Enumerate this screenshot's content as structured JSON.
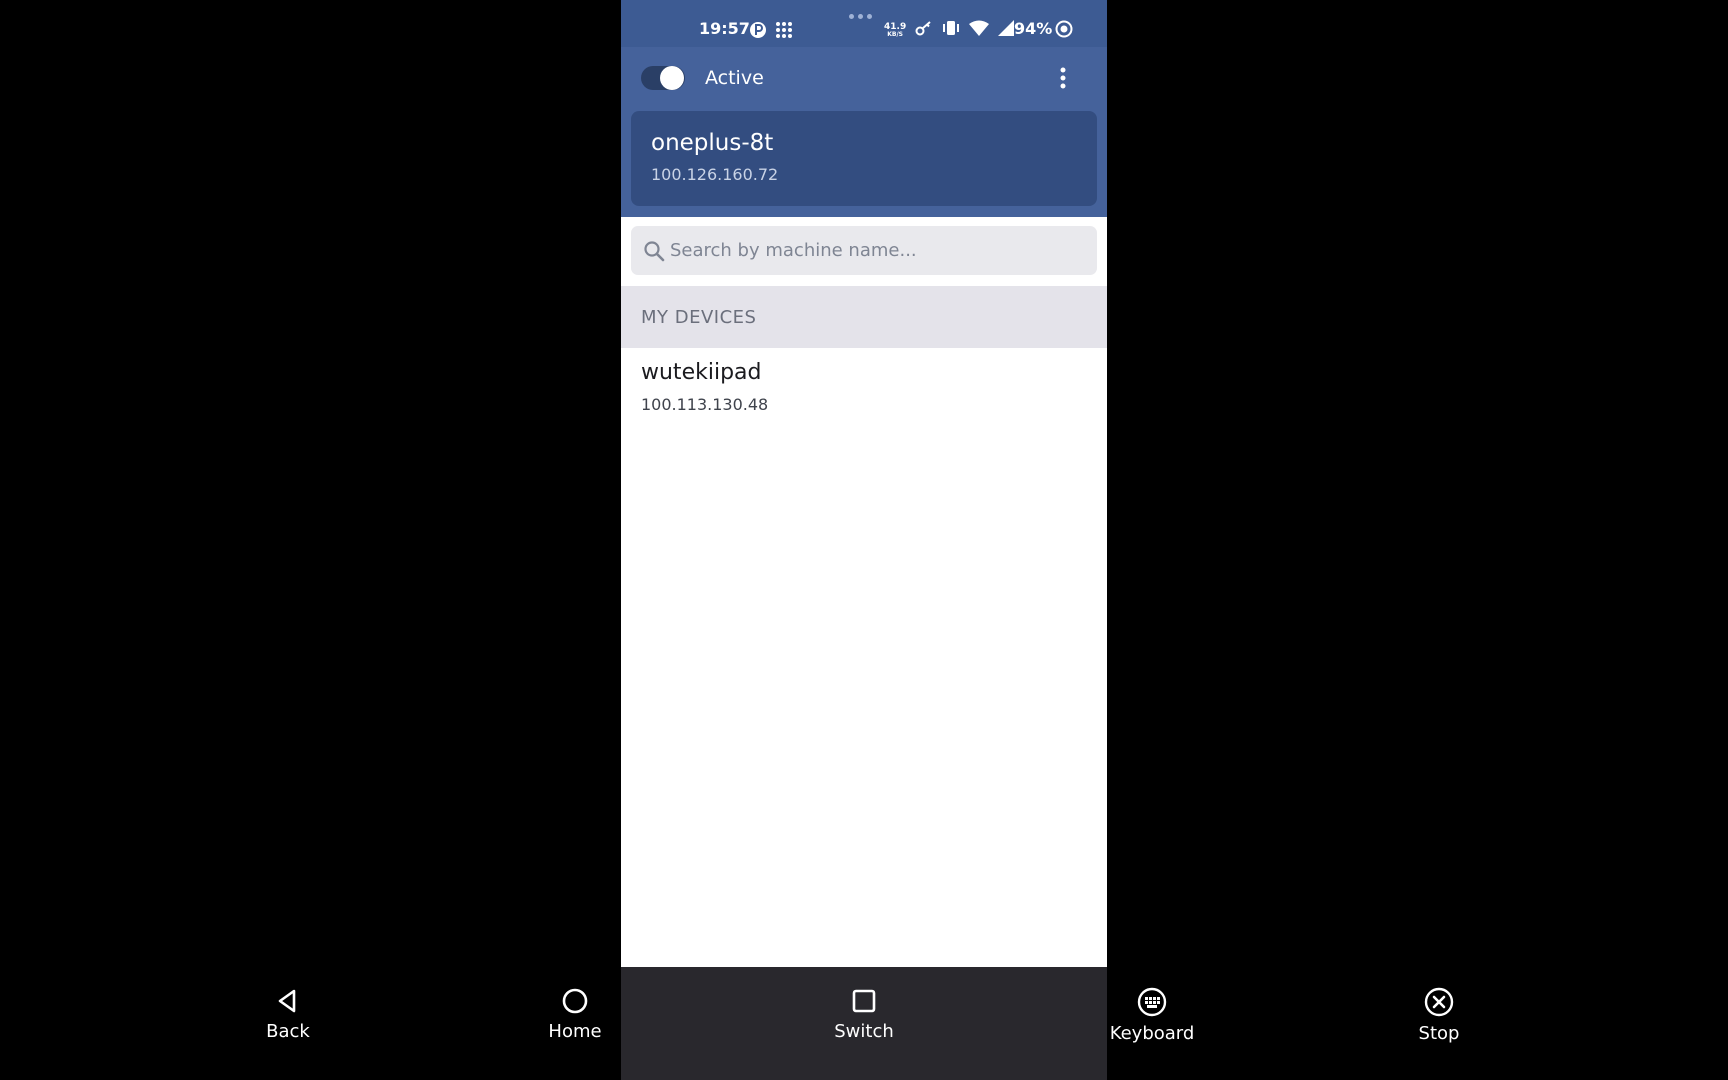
{
  "status_bar": {
    "time": "19:57",
    "net_speed_value": "41.9",
    "net_speed_unit": "KB/S",
    "battery": "94%",
    "icons": [
      "p-badge-icon",
      "grid-icon",
      "key-icon",
      "vibrate-icon",
      "wifi-icon",
      "cell-signal-icon",
      "sync-icon"
    ]
  },
  "header": {
    "toggle_state": "on",
    "status_label": "Active",
    "menu_icon": "more-vertical-icon"
  },
  "current_device": {
    "name": "oneplus-8t",
    "ip": "100.126.160.72"
  },
  "search": {
    "placeholder": "Search by machine name..."
  },
  "sections": {
    "my_devices_title": "MY DEVICES"
  },
  "devices": [
    {
      "name": "wutekiipad",
      "ip": "100.113.130.48"
    }
  ],
  "remote_controls": [
    {
      "label": "Back",
      "icon": "triangle-back-icon"
    },
    {
      "label": "Home",
      "icon": "circle-home-icon"
    },
    {
      "label": "Switch",
      "icon": "square-switch-icon"
    },
    {
      "label": "Keyboard",
      "icon": "keyboard-icon"
    },
    {
      "label": "Stop",
      "icon": "close-circle-icon"
    }
  ],
  "colors": {
    "status_bar": "#3d5b93",
    "header": "#45629b",
    "current_card": "#334d80",
    "search_bg": "#e9e9ed",
    "section_bg": "#e4e3ea",
    "bottom_bar": "#29282d"
  }
}
